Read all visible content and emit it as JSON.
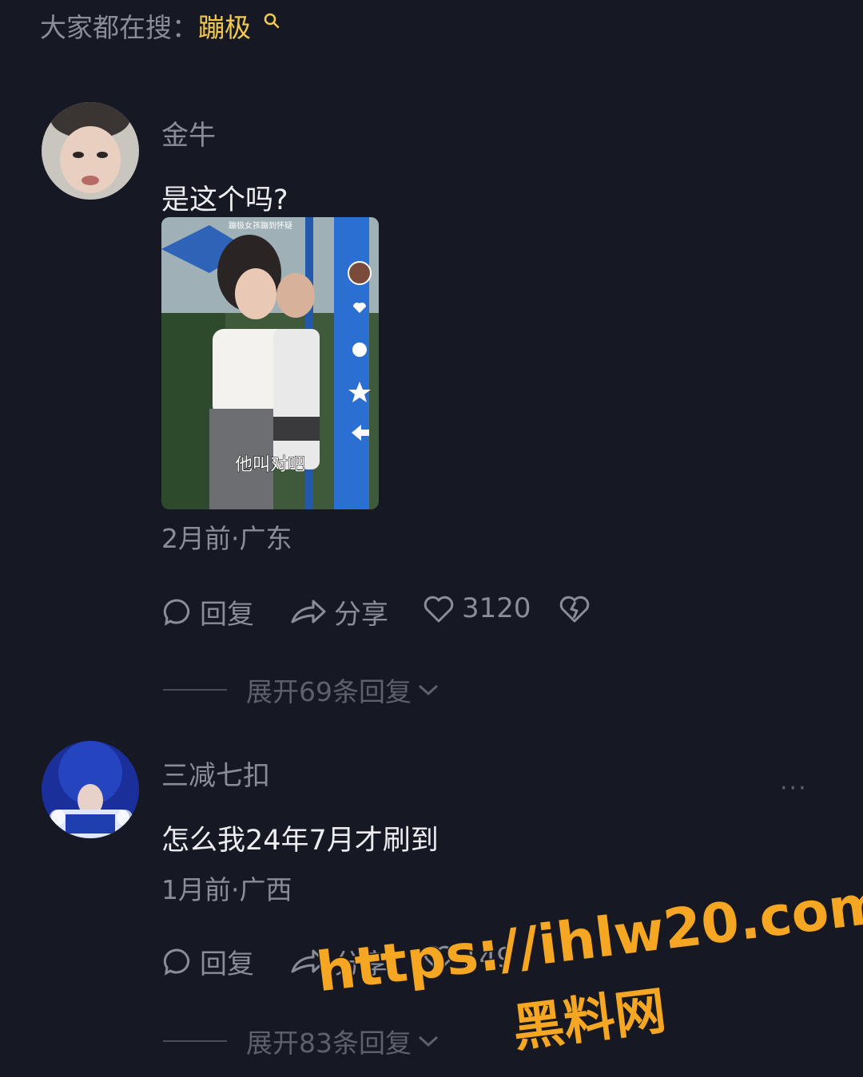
{
  "search_hint": {
    "prefix": "大家都在搜：",
    "keyword": "蹦极"
  },
  "comments": [
    {
      "username": "金牛",
      "text": "是这个吗?",
      "media": {
        "top_caption": "蹦极女孩蹦到怀疑",
        "subtitle": "他叫对吧"
      },
      "meta": "2月前·广东",
      "reply_label": "回复",
      "share_label": "分享",
      "like_count": "3120",
      "expand_label": "展开69条回复"
    },
    {
      "username": "三减七扣",
      "text": "怎么我24年7月才刷到",
      "meta": "1月前·广西",
      "reply_label": "回复",
      "share_label": "分享",
      "like_count": "149",
      "expand_label": "展开83条回复",
      "more_label": "···"
    }
  ],
  "watermark": {
    "url": "https://ihlw20.com",
    "name": "黑料网"
  },
  "colors": {
    "background": "#161823",
    "keyword": "#f2c94c",
    "watermark": "#f5a623",
    "muted": "#8a8c96"
  }
}
